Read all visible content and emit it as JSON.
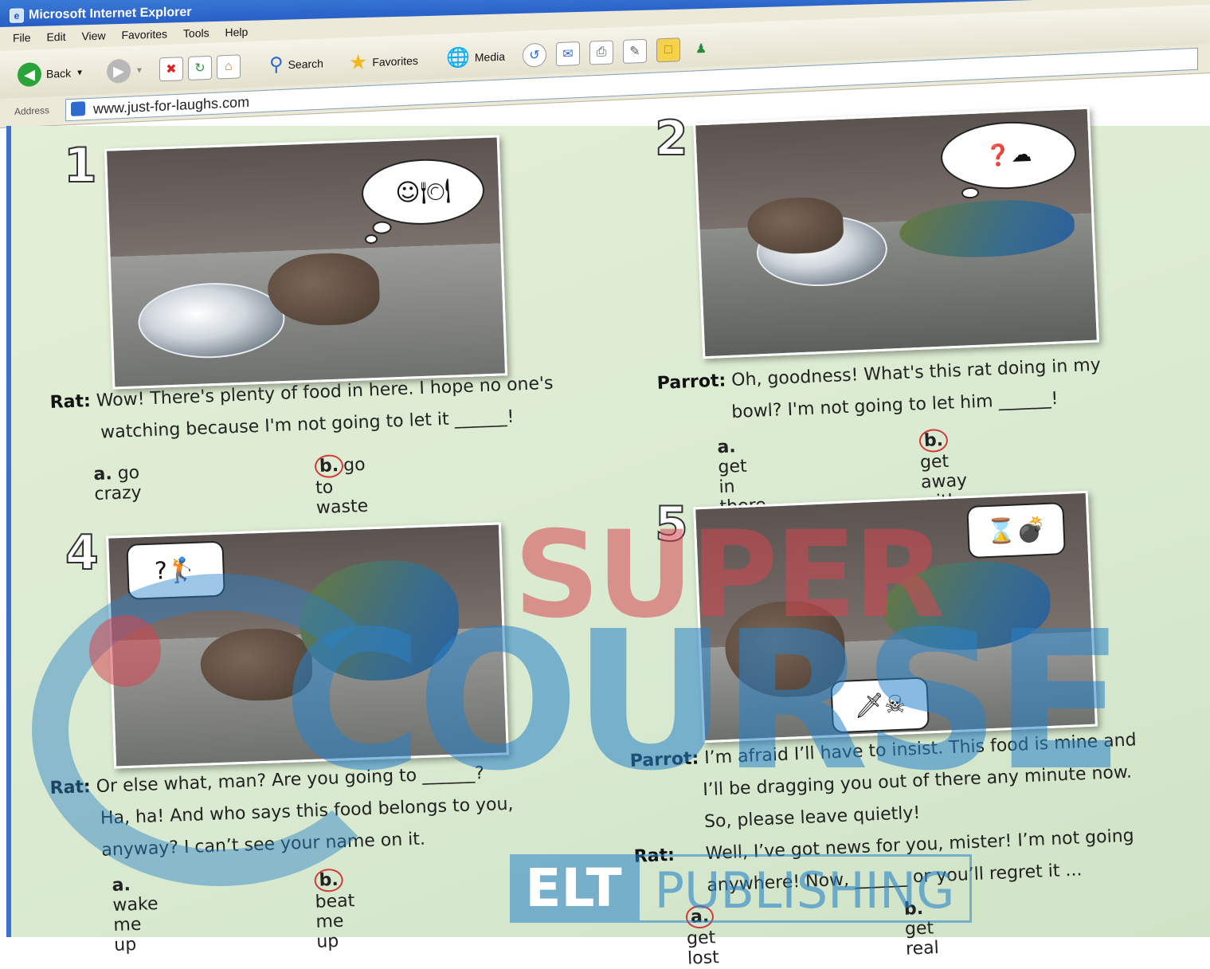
{
  "window": {
    "title": "Microsoft Internet Explorer"
  },
  "menu": [
    "File",
    "Edit",
    "View",
    "Favorites",
    "Tools",
    "Help"
  ],
  "toolbar": {
    "back": "Back",
    "search": "Search",
    "favorites": "Favorites",
    "media": "Media"
  },
  "address": {
    "label": "Address",
    "url": "www.just-for-laughs.com"
  },
  "panels": [
    {
      "number": "1",
      "speaker": "Rat:",
      "line1": "Wow! There's plenty of food in here. I hope no one's",
      "line2": "watching because I'm not going to let it ______!",
      "opt_a_letter": "a.",
      "opt_a": "go crazy",
      "opt_b_letter": "b.",
      "opt_b": "go to waste",
      "selected": "b"
    },
    {
      "number": "2",
      "speaker": "Parrot:",
      "line1": "Oh, goodness! What's this rat doing in my",
      "line2": "bowl? I'm not going to let him ______!",
      "opt_a_letter": "a.",
      "opt_a": "get in there",
      "opt_b_letter": "b.",
      "opt_b": "get away with it",
      "selected": "b"
    },
    {
      "number": "4",
      "speaker": "Rat:",
      "line1": "Or else what, man? Are you going to ______?",
      "line2": "Ha, ha! And who says this food belongs to you,",
      "line3": "anyway? I can’t see your name on it.",
      "opt_a_letter": "a.",
      "opt_a": "wake me up",
      "opt_b_letter": "b.",
      "opt_b": "beat me up",
      "selected": "b"
    },
    {
      "number": "5",
      "speaker": "Parrot:",
      "line1": "I’m afraid I’ll have to insist. This food is mine and",
      "line2": "I’ll be dragging you out of there any minute now.",
      "line3": "So, please leave quietly!",
      "speaker2": "Rat:",
      "line4": "Well, I’ve got news for you, mister! I’m not going",
      "line5": "anywhere! Now, ______ or you’ll regret it ...",
      "opt_a_letter": "a.",
      "opt_a": "get lost",
      "opt_b_letter": "b.",
      "opt_b": "get real",
      "selected": "a"
    }
  ],
  "watermark": {
    "super": "SUPER",
    "course": "COURSE",
    "elt": "ELT",
    "publishing": "PUBLISHING"
  }
}
